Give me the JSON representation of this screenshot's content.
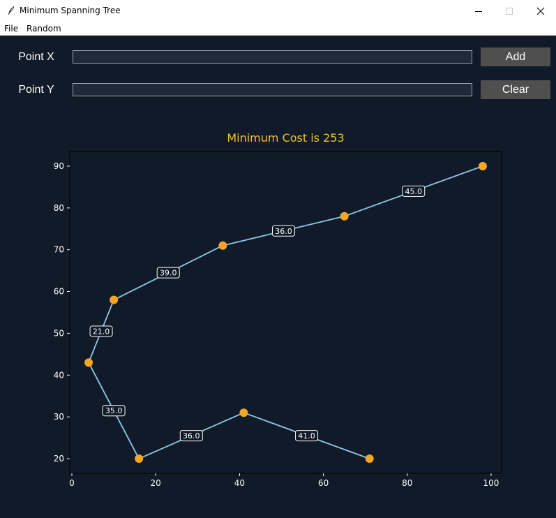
{
  "window": {
    "title": "Minimum Spanning Tree",
    "controls": [
      "minimize",
      "maximize",
      "close"
    ]
  },
  "menu": {
    "items": [
      "File",
      "Random"
    ]
  },
  "form": {
    "x_label": "Point X",
    "y_label": "Point Y",
    "x_value": "",
    "y_value": "",
    "add_label": "Add",
    "clear_label": "Clear"
  },
  "colors": {
    "background": "#111a28",
    "title": "#f0c030",
    "point": "#f5a623",
    "edge": "#8ecae6",
    "button": "#4f4f4f"
  },
  "chart_data": {
    "type": "scatter",
    "title": "Minimum Cost is 253",
    "xlabel": "",
    "ylabel": "",
    "xlim": [
      -0.5,
      102.5
    ],
    "ylim": [
      16.5,
      93.5
    ],
    "xticks": [
      0,
      20,
      40,
      60,
      80,
      100
    ],
    "yticks": [
      20,
      30,
      40,
      50,
      60,
      70,
      80,
      90
    ],
    "grid": false,
    "points": [
      {
        "x": 4,
        "y": 43
      },
      {
        "x": 10,
        "y": 58
      },
      {
        "x": 36,
        "y": 71
      },
      {
        "x": 65,
        "y": 78
      },
      {
        "x": 98,
        "y": 90
      },
      {
        "x": 16,
        "y": 20
      },
      {
        "x": 41,
        "y": 31
      },
      {
        "x": 71,
        "y": 20
      }
    ],
    "edges": [
      {
        "from": [
          4,
          43
        ],
        "to": [
          10,
          58
        ],
        "weight": "21.0"
      },
      {
        "from": [
          10,
          58
        ],
        "to": [
          36,
          71
        ],
        "weight": "39.0"
      },
      {
        "from": [
          36,
          71
        ],
        "to": [
          65,
          78
        ],
        "weight": "36.0"
      },
      {
        "from": [
          65,
          78
        ],
        "to": [
          98,
          90
        ],
        "weight": "45.0"
      },
      {
        "from": [
          4,
          43
        ],
        "to": [
          16,
          20
        ],
        "weight": "35.0"
      },
      {
        "from": [
          16,
          20
        ],
        "to": [
          41,
          31
        ],
        "weight": "36.0"
      },
      {
        "from": [
          41,
          31
        ],
        "to": [
          71,
          20
        ],
        "weight": "41.0"
      }
    ]
  }
}
